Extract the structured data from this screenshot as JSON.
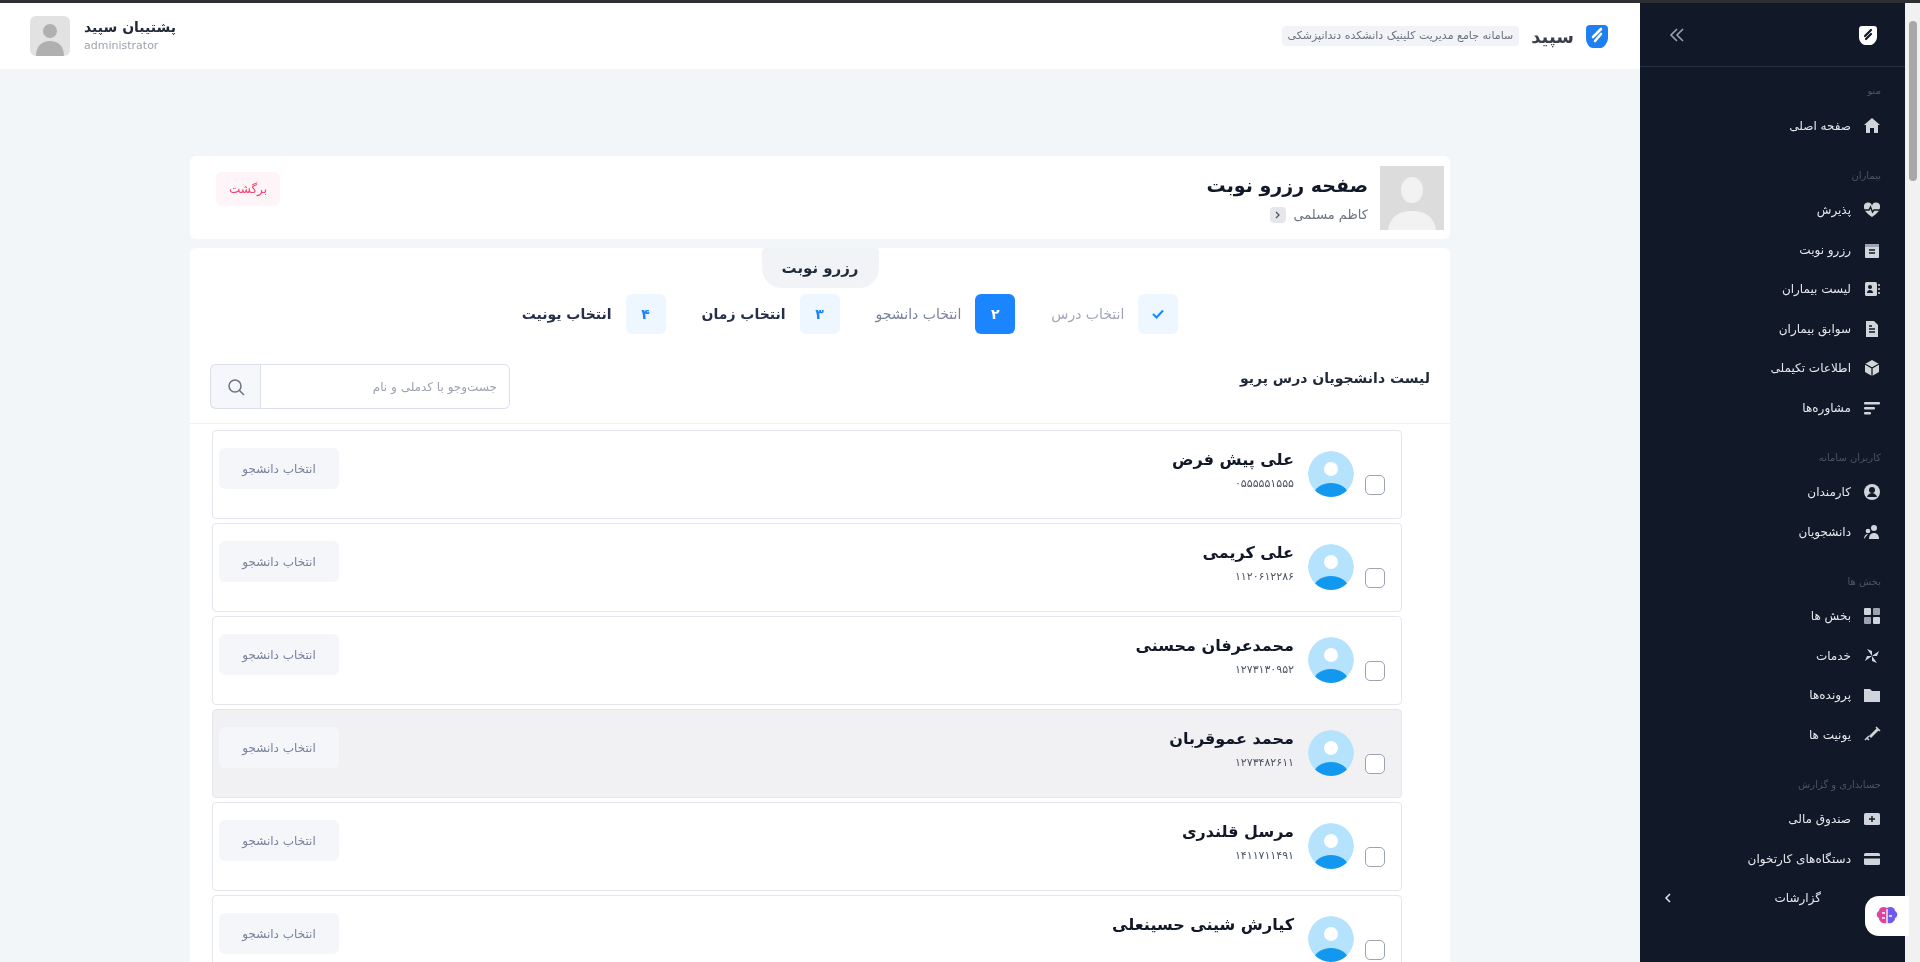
{
  "header": {
    "brand": "سپید",
    "tagline": "سامانه جامع مدیریت کلینیک دانشکده دندانپزشکی",
    "user": {
      "name": "پشتیبان سپید",
      "role": "administrator"
    }
  },
  "sidebar": {
    "sections": [
      {
        "title": "منو",
        "items": [
          {
            "kind": "link",
            "label": "صفحه اصلی"
          }
        ]
      },
      {
        "title": "بیماران",
        "items": [
          {
            "kind": "link",
            "label": "پذیرش"
          },
          {
            "kind": "link",
            "label": "رزرو نوبت"
          },
          {
            "kind": "link",
            "label": "لیست بیماران"
          },
          {
            "kind": "link",
            "label": "سوابق بیماران"
          },
          {
            "kind": "link",
            "label": "اطلاعات تکیملی"
          },
          {
            "kind": "link",
            "label": "مشاوره‌ها"
          }
        ]
      },
      {
        "title": "کاربران سامانه",
        "items": [
          {
            "kind": "link",
            "label": "کارمندان"
          },
          {
            "kind": "link",
            "label": "دانشجویان"
          }
        ]
      },
      {
        "title": "بخش ها",
        "items": [
          {
            "kind": "link",
            "label": "بخش ها"
          },
          {
            "kind": "link",
            "label": "خدمات"
          },
          {
            "kind": "link",
            "label": "پرونده‌ها"
          },
          {
            "kind": "link",
            "label": "یونیت ها"
          }
        ]
      },
      {
        "title": "حسابداری و گزارش",
        "items": [
          {
            "kind": "link",
            "label": "صندوق مالی"
          },
          {
            "kind": "link",
            "label": "دستگاه‌های کارتخوان"
          },
          {
            "kind": "group",
            "label": "گزارشات",
            "expanded": false
          }
        ]
      }
    ]
  },
  "page_header": {
    "title": "صفحه رزرو نوبت",
    "patient": "کاظم مسلمی",
    "back_button": "برگشت"
  },
  "booking": {
    "tab": "رزرو نوبت",
    "steps": [
      {
        "label": "انتخاب درس",
        "completed": true,
        "selected": false
      },
      {
        "number": "۲",
        "label": "انتخاب دانشجو",
        "completed": false,
        "selected": true
      },
      {
        "number": "۳",
        "label": "انتخاب زمان",
        "completed": false,
        "selected": false
      },
      {
        "number": "۴",
        "label": "انتخاب یونیت",
        "completed": false,
        "selected": false
      }
    ]
  },
  "students": {
    "title": "لیست دانشجویان درس پریو",
    "search": {
      "placeholder": "جست‌وجو با کدملی و نام"
    },
    "rows": [
      {
        "name": "علی پیش فرض",
        "national_id": "۰۵۵۵۵۵۱۵۵۵",
        "checked": false,
        "highlighted": false,
        "button": "انتخاب دانشجو"
      },
      {
        "name": "علی کریمی",
        "national_id": "۱۱۲۰۶۱۲۲۸۶",
        "checked": false,
        "highlighted": false,
        "button": "انتخاب دانشجو"
      },
      {
        "name": "محمدعرفان محسنی",
        "national_id": "۱۲۷۳۱۳۰۹۵۲",
        "checked": false,
        "highlighted": false,
        "button": "انتخاب دانشجو"
      },
      {
        "name": "محمد عموقربان",
        "national_id": "۱۲۷۳۴۸۲۶۱۱",
        "checked": false,
        "highlighted": true,
        "button": "انتخاب دانشجو"
      },
      {
        "name": "مرسل قلندری",
        "national_id": "۱۴۱۱۷۱۱۴۹۱",
        "checked": false,
        "highlighted": false,
        "button": "انتخاب دانشجو"
      },
      {
        "name": "کیارش شینی حسینعلی",
        "checked": false,
        "highlighted": false,
        "button": "انتخاب دانشجو"
      }
    ]
  }
}
